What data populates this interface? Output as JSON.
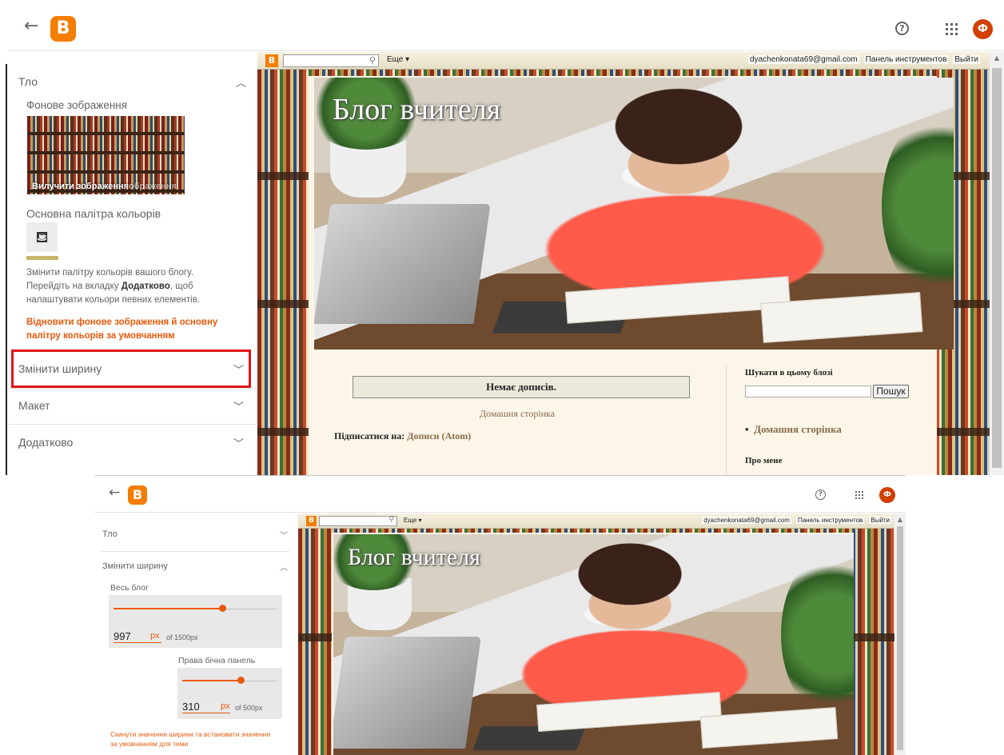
{
  "app": {
    "logo_letter": "B",
    "avatar_letter": "Ф",
    "help_glyph": "?",
    "back_glyph": "←",
    "brand_color": "#f57d00",
    "avatar_color": "#d23f00",
    "link_color": "#e8590c"
  },
  "top": {
    "sections": {
      "background": "Тло",
      "width": "Змінити ширину",
      "layout": "Макет",
      "advanced": "Додатково"
    },
    "bg_image_label": "Фонове зображення",
    "remove_image": "Вилучити зображення",
    "remove_image_ghost": "ображення",
    "palette_label": "Основна палітра кольорів",
    "palette_icon": "paint-bucket-icon",
    "desc_part1": "Змінити палітру кольорів вашого блогу. Перейдіть на вкладку ",
    "desc_bold": "Додатково",
    "desc_part2": ", щоб налаштувати кольори певних елементів.",
    "reset_link": "Відновити фонове зображення й основну палітру кольорів за умовчанням"
  },
  "bottom": {
    "sections": {
      "background": "Тло",
      "width": "Змінити ширину"
    },
    "whole_blog_label": "Весь блог",
    "whole_blog_value": "997",
    "whole_blog_unit": "px",
    "whole_blog_max": "of 1500px",
    "whole_blog_fraction": 0.665,
    "sidebar_label": "Права бічна панель",
    "sidebar_value": "310",
    "sidebar_unit": "px",
    "sidebar_max": "of 500px",
    "sidebar_fraction": 0.62,
    "reset_link": "Скинути значення ширини та встановити значення за умовчанням для теми"
  },
  "navbar": {
    "logo_letter": "B",
    "search_glyph": "⚲",
    "more": "Еще ▾",
    "email": "dyachenkonata69@gmail.com",
    "dashboard": "Панель инструментов",
    "logout": "Выйти"
  },
  "blog": {
    "title": "Блог вчителя",
    "no_posts": "Немає дописів.",
    "home_link": "Домашня сторінка",
    "subscribe_label": "Підписатися на: ",
    "subscribe_link": "Дописи (Atom)",
    "search_heading": "Шукати в цьому блозі",
    "search_button": "Пошук",
    "sidebar_home": "Домашня сторінка",
    "about_heading": "Про мене"
  }
}
